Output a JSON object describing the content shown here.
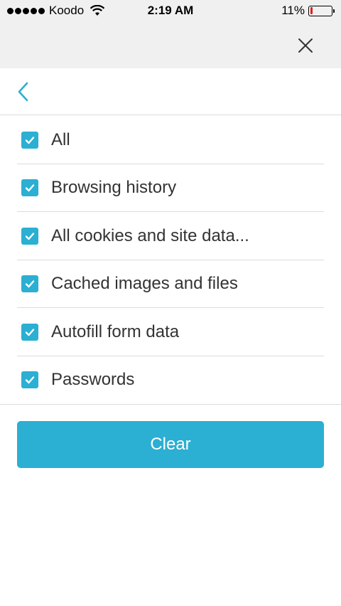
{
  "status_bar": {
    "carrier": "Koodo",
    "time": "2:19 AM",
    "battery_percent": "11%",
    "battery_level": 0.11,
    "signal_bars": 5
  },
  "header": {
    "close_icon": "close-icon",
    "back_icon": "chevron-left-icon"
  },
  "options": [
    {
      "label": "All",
      "checked": true
    },
    {
      "label": "Browsing history",
      "checked": true
    },
    {
      "label": "All cookies and site data...",
      "checked": true
    },
    {
      "label": "Cached images and files",
      "checked": true
    },
    {
      "label": "Autofill form data",
      "checked": true
    },
    {
      "label": "Passwords",
      "checked": true
    }
  ],
  "actions": {
    "clear_label": "Clear"
  },
  "colors": {
    "accent": "#2bafd2",
    "battery_low": "#e02020",
    "header_bg": "#f0f0f0"
  }
}
